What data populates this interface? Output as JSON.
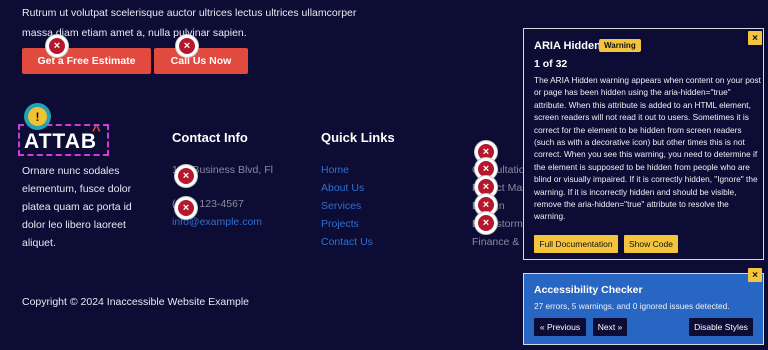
{
  "intro": "Rutrum ut volutpat scelerisque auctor ultrices lectus ultrices ullamcorper massa diam etiam amet a, nulla pulvinar sapien.",
  "buttons": {
    "estimate": "Get a Free Estimate",
    "call": "Call Us Now"
  },
  "logo": {
    "text": "ATTAB",
    "caret": "^"
  },
  "about": "Ornare nunc sodales elementum, fusce dolor platea quam ac porta id dolor leo libero laoreet aliquet.",
  "contact": {
    "title": "Contact Info",
    "address": "123 Business Blvd, Fl",
    "phone": "(555) 123-4567",
    "email": "info@example.com"
  },
  "quick_links": {
    "title": "Quick Links",
    "items": [
      "Home",
      "About Us",
      "Services",
      "Projects",
      "Contact Us"
    ]
  },
  "services": {
    "items": [
      "Consultation",
      "Project Management",
      "Design",
      "Brainstorming",
      "Finance & Insurance"
    ]
  },
  "copyright": "Copyright © 2024 Inaccessible Website Example",
  "icons": {
    "error": "x-icon",
    "warning": "warning-triangle-icon",
    "close": "close-icon"
  },
  "colors": {
    "background": "#0d0c35",
    "cta": "#e04a3f",
    "link": "#2f6fd0",
    "warning": "#f4c53c",
    "error": "#b3182d",
    "checker": "#2766c3"
  },
  "aria_panel": {
    "title": "ARIA Hidden",
    "badge": "Warning",
    "count": "1 of 32",
    "body": "The ARIA Hidden warning appears when content on your post or page has been hidden using the aria-hidden=\"true\" attribute. When this attribute is added to an HTML element, screen readers will not read it out to users. Sometimes it is correct for the element to be hidden from screen readers (such as with a decorative icon) but other times this is not correct. When you see this warning, you need to determine if the element is supposed to be hidden from people who are blind or visually impaired. If it is correctly hidden, \"Ignore\" the warning. If it is incorrectly hidden and should be visible, remove the aria-hidden=\"true\" attribute to resolve the warning.",
    "full_doc": "Full Documentation",
    "show_code": "Show Code",
    "close": "×"
  },
  "checker": {
    "title": "Accessibility Checker",
    "summary": "27 errors, 5 warnings, and 0 ignored issues detected.",
    "previous": "« Previous",
    "next": "Next »",
    "disable": "Disable Styles",
    "close": "×"
  }
}
